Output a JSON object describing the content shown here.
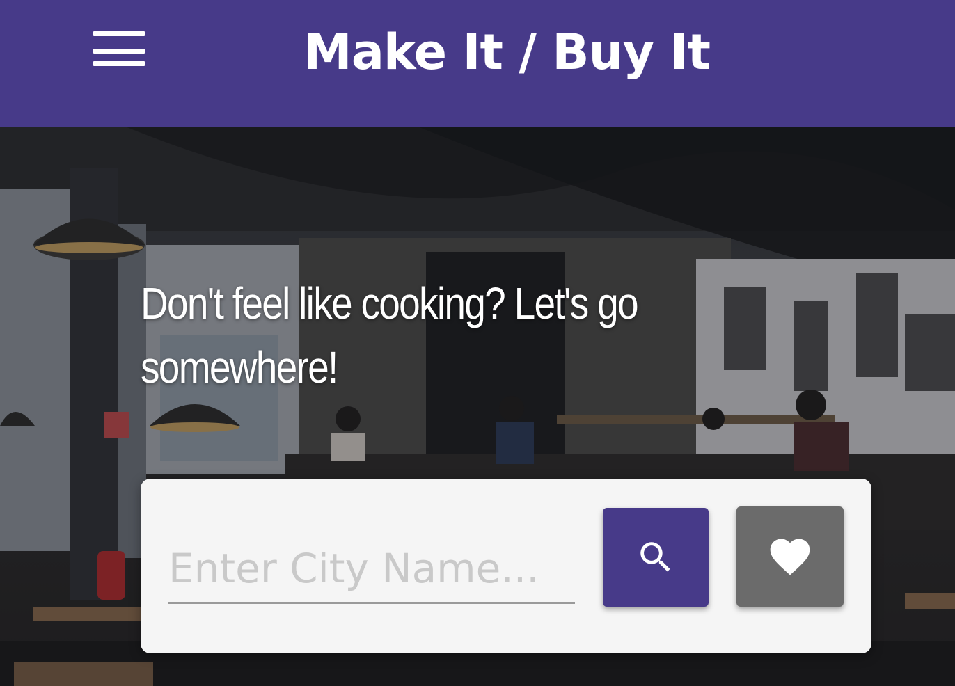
{
  "header": {
    "title": "Make It / Buy It",
    "menu_icon": "hamburger-menu-icon"
  },
  "hero": {
    "headline": "Don't feel like cooking? Let's go somewhere!",
    "background": "cafe-interior-photo"
  },
  "search": {
    "placeholder": "Enter City Name...",
    "value": "",
    "search_icon": "search-icon",
    "favorite_icon": "heart-icon"
  },
  "colors": {
    "primary": "#473a89",
    "favorite_button": "#6b6b6b",
    "card": "#f5f5f5"
  }
}
